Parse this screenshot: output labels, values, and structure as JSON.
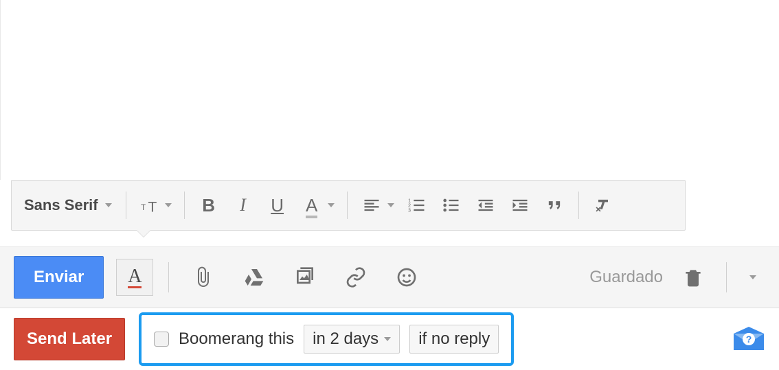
{
  "format_bar": {
    "font_family": "Sans Serif",
    "buttons": {
      "bold": "B",
      "italic": "I",
      "underline": "U",
      "text_color": "A"
    }
  },
  "send_row": {
    "send_label": "Enviar",
    "format_toggle": "A",
    "status": "Guardado"
  },
  "boomerang": {
    "send_later_label": "Send Later",
    "label": "Boomerang this",
    "time_value": "in 2 days",
    "condition_value": "if no reply"
  }
}
